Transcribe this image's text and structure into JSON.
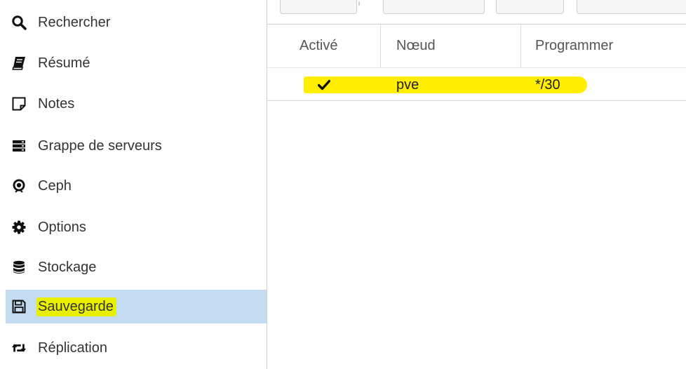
{
  "sidebar": {
    "items": [
      {
        "label": "Rechercher",
        "icon": "search-icon"
      },
      {
        "label": "Résumé",
        "icon": "book-icon"
      },
      {
        "label": "Notes",
        "icon": "sticky-note-icon"
      },
      {
        "label": "Grappe de serveurs",
        "icon": "server-icon"
      },
      {
        "label": "Ceph",
        "icon": "ceph-icon"
      },
      {
        "label": "Options",
        "icon": "gear-icon"
      },
      {
        "label": "Stockage",
        "icon": "database-icon"
      },
      {
        "label": "Sauvegarde",
        "icon": "floppy-disk-icon",
        "selected": true
      },
      {
        "label": "Réplication",
        "icon": "retweet-icon"
      }
    ]
  },
  "grid": {
    "columns": [
      "Activé",
      "Nœud",
      "Programmer"
    ],
    "rows": [
      {
        "enabled_icon": "check-icon",
        "node": "pve",
        "schedule": "*/30"
      }
    ]
  },
  "colors": {
    "selected_bg": "#c4dcf2",
    "highlight": "#ffee00",
    "text": "#333333"
  }
}
